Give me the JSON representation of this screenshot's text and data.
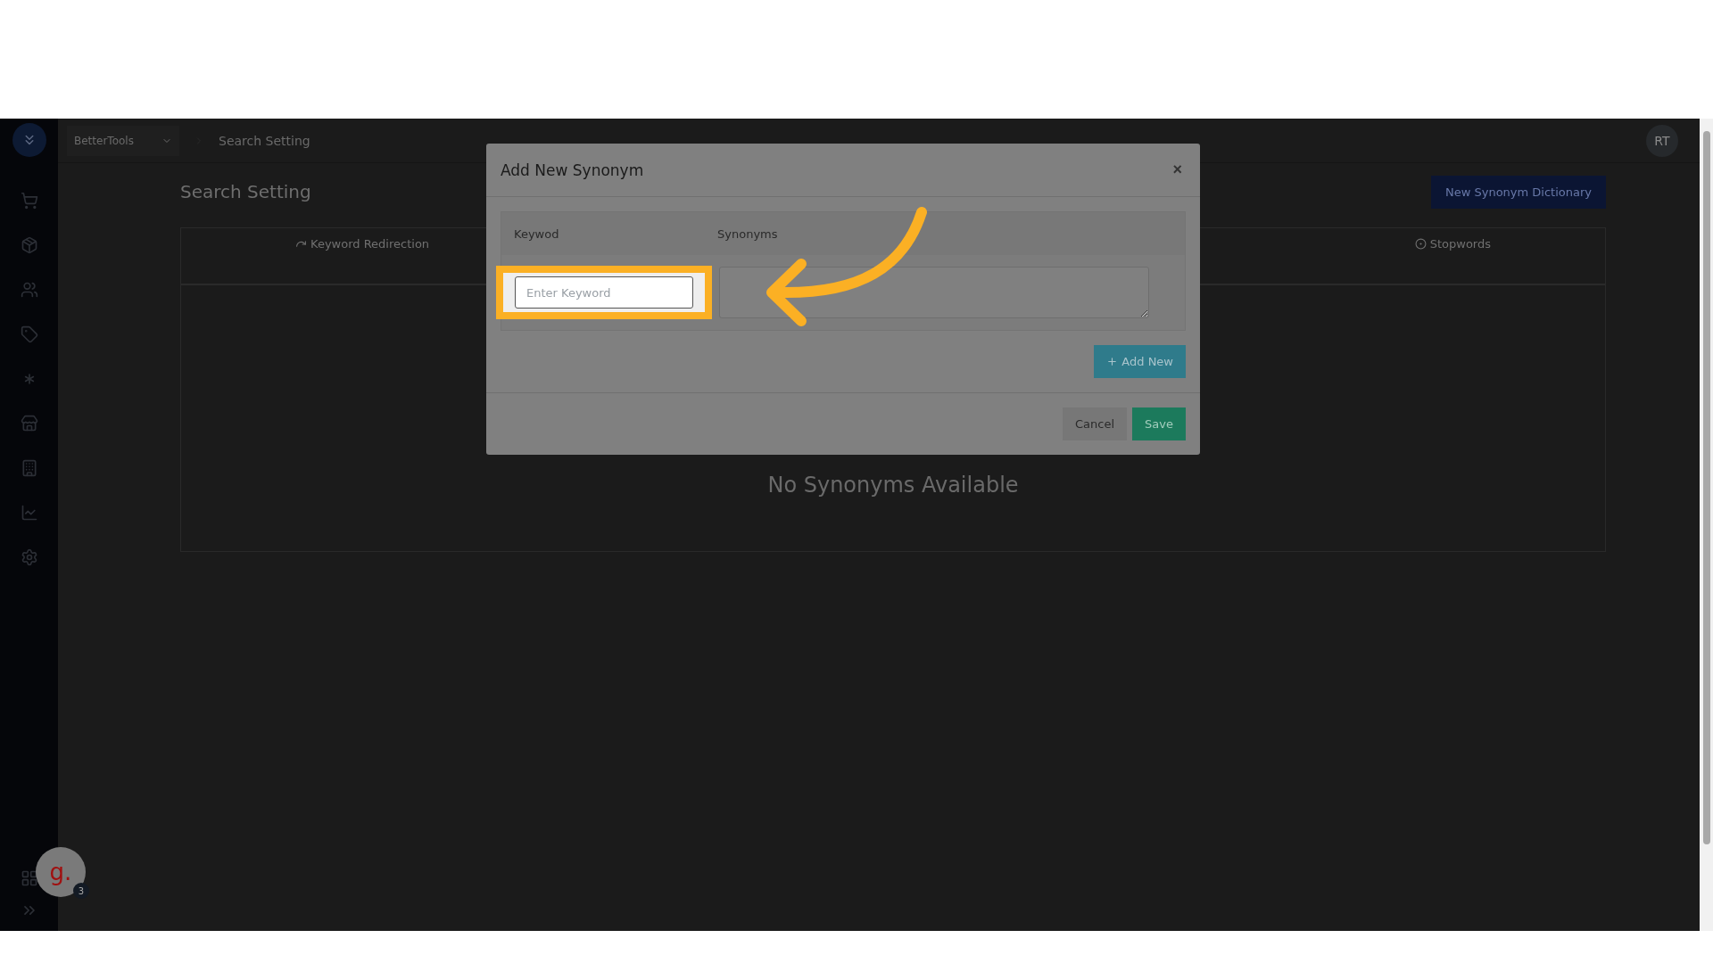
{
  "topbar": {
    "store": "BetterTools",
    "breadcrumb": "Search Setting",
    "avatar": "RT"
  },
  "page": {
    "title": "Search Setting",
    "action": "New Synonym Dictionary"
  },
  "tabs": [
    {
      "label": "Keyword Redirection",
      "kind": "redirect"
    },
    {
      "label": "Stopwords",
      "kind": "stop"
    }
  ],
  "empty_message": "No Synonyms Available",
  "modal": {
    "title": "Add New Synonym",
    "close": "×",
    "columns": [
      "Keywod",
      "Synonyms"
    ],
    "keyword_placeholder": "Enter Keyword",
    "add_button": "Add New",
    "cancel": "Cancel",
    "save": "Save"
  },
  "help_widget": {
    "logo": "g.",
    "badge": "3"
  }
}
